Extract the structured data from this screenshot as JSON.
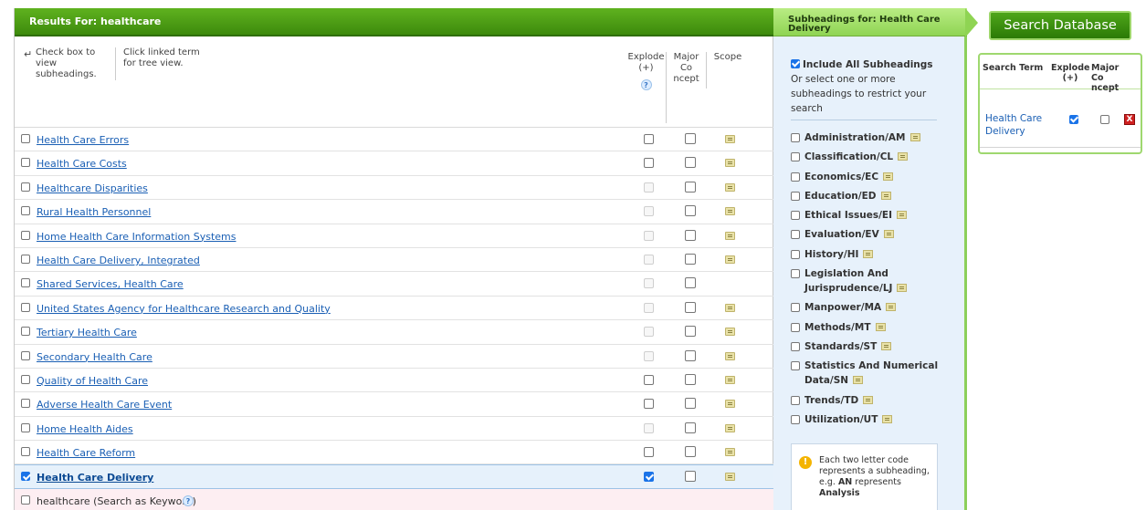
{
  "results": {
    "header": "Results For: healthcare",
    "hint_check": "Check box to view subheadings.",
    "hint_click": "Click linked term for tree view.",
    "col_explode": "Explode (+)",
    "col_major": "Major Co ncept",
    "col_scope": "Scope",
    "rows": [
      {
        "term": "Health Care Errors"
      },
      {
        "term": "Health Care Costs"
      },
      {
        "term": "Healthcare Disparities"
      },
      {
        "term": "Rural Health Personnel"
      },
      {
        "term": "Home Health Care Information Systems"
      },
      {
        "term": "Health Care Delivery, Integrated"
      },
      {
        "term": "Shared Services, Health Care"
      },
      {
        "term": "United States Agency for Healthcare Research and Quality"
      },
      {
        "term": "Tertiary Health Care"
      },
      {
        "term": "Secondary Health Care"
      },
      {
        "term": "Quality of Health Care"
      },
      {
        "term": "Adverse Health Care Event"
      },
      {
        "term": "Home Health Aides"
      },
      {
        "term": "Health Care Reform"
      },
      {
        "term": "Health Care Delivery"
      }
    ],
    "keyword_row": "healthcare (Search as Keyword)"
  },
  "subheadings": {
    "header": "Subheadings for: Health Care Delivery",
    "include_all": "Include All Subheadings",
    "instructions": "Or select one or more subheadings to restrict your search",
    "items": [
      "Administration/AM",
      "Classification/CL",
      "Economics/EC",
      "Education/ED",
      "Ethical Issues/EI",
      "Evaluation/EV",
      "History/HI",
      "Legislation And Jurisprudence/LJ",
      "Manpower/MA",
      "Methods/MT",
      "Standards/ST",
      "Statistics And Numerical Data/SN",
      "Trends/TD",
      "Utilization/UT"
    ],
    "info_text_1": "Each two letter code represents a subheading, e.g.",
    "info_code": "AN",
    "info_text_2": "represents",
    "info_example": "Analysis"
  },
  "search_button": "Search Database",
  "builder": {
    "col_term": "Search Term",
    "col_explode": "Explode (+)",
    "col_major": "Major Co ncept",
    "term": "Health Care Delivery",
    "remove_icon": "X"
  },
  "icons": {
    "help": "?",
    "info": "!"
  },
  "colors": {
    "header_green": "#3d8a0c",
    "sub_header_green": "#8fd453",
    "link_blue": "#1a5fb4",
    "selected_row": "#e6f1fb",
    "keyword_row": "#fdeef2",
    "remove_red": "#d02020"
  }
}
